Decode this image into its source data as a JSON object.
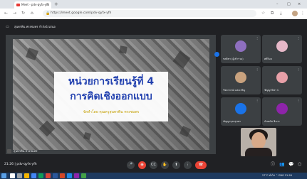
{
  "browser": {
    "tab_title": "Meet - pdv-qyfx-yfh",
    "url": "https://meet.google.com/pdv-qyfx-yfh",
    "new_tab_symbol": "+",
    "close_symbol": "×",
    "minimize_symbol": "–",
    "maximize_symbol": "□"
  },
  "meet": {
    "header_text": "สุนทรพิน ทรงชมพร กำลังนำเสนอ",
    "presenter_label": "สุนทรพิน ทรงชมพร",
    "slide": {
      "title_line1": "หน่วยการเรียนรู้ที่ 4",
      "title_line2": "การคิดเชิงออกแบบ",
      "author": "จัดทำโดย คุณครูสุนทรพิน ทรงชมพร"
    },
    "participants": [
      {
        "name": "ชลธิชา (ผู้เข้าร่วม)",
        "avatar_color": "#8e6fbf"
      },
      {
        "name": "ศศิวิมล",
        "avatar_color": "#e6b8c8"
      },
      {
        "name": "รัชดาภรณ์ แสงเจริญ",
        "avatar_color": "#c9a27e"
      },
      {
        "name": "ชัญญานิชา C",
        "avatar_color": "#e8a0a8"
      },
      {
        "name": "ชัญญานุช สุนทร",
        "avatar_color": "#1a73e8"
      },
      {
        "name": "นันทนัช ชินวร",
        "avatar_color": "#8e24aa"
      }
    ],
    "more_symbol": "⋮",
    "time_code": "21:26 | pdv-qyfx-yfh",
    "controls": {
      "mic": "🎤",
      "cam": "◉",
      "captions": "CC",
      "hand": "✋",
      "present": "⬆",
      "more": "⋮",
      "end": "☎"
    }
  },
  "taskbar": {
    "tray_text": "27°C ทั่วไป ⌃ ENG 21:26"
  }
}
